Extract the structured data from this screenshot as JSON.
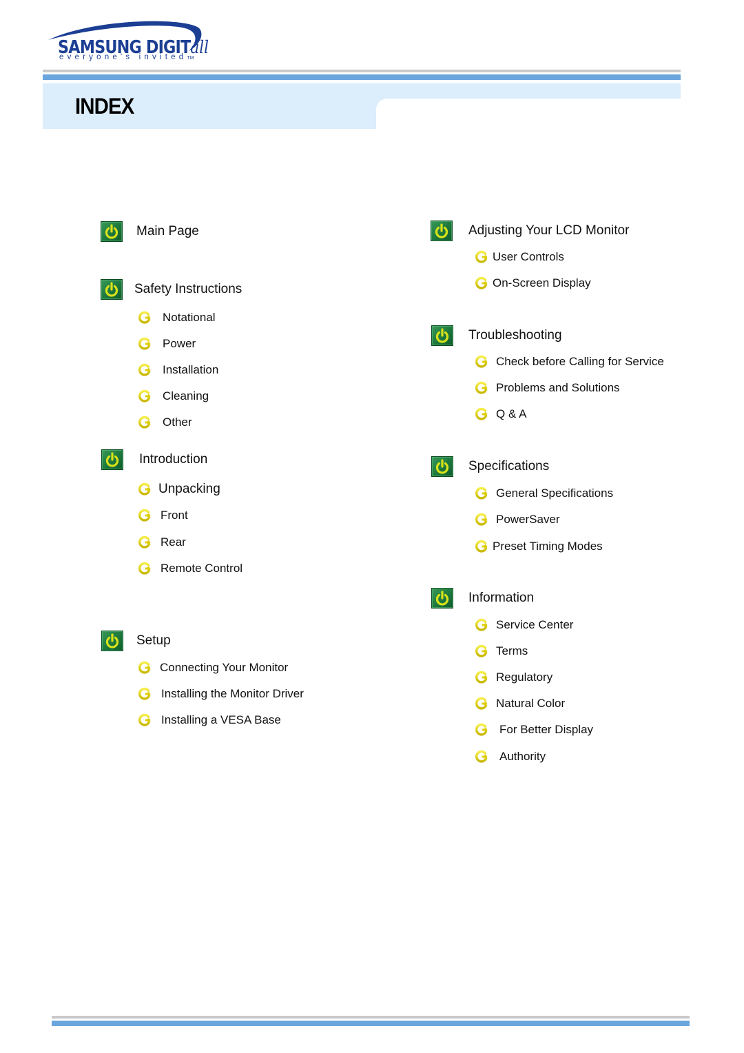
{
  "brand": {
    "logo_word": "SAMSUNG DIGIT",
    "logo_word_suffix": "all",
    "logo_tagline": "everyone's invited",
    "logo_tm": "TM",
    "colors": {
      "brand_blue": "#1c3f94",
      "header_bar_blue": "#6aa6dd",
      "header_panel": "#dcedfb",
      "divider_grey": "#c9c9c9",
      "icon_green": "#1f7a3e",
      "icon_yellow": "#e8e21c"
    }
  },
  "header": {
    "title": "INDEX"
  },
  "left_column": [
    {
      "title": "Main Page",
      "icon": "power-icon",
      "items": []
    },
    {
      "title": "Safety Instructions",
      "icon": "power-icon",
      "items": [
        {
          "label": "Notational",
          "icon": "arrow-circle-icon"
        },
        {
          "label": "Power",
          "icon": "arrow-circle-icon"
        },
        {
          "label": "Installation",
          "icon": "arrow-circle-icon"
        },
        {
          "label": "Cleaning",
          "icon": "arrow-circle-icon"
        },
        {
          "label": "Other",
          "icon": "arrow-circle-icon"
        }
      ]
    },
    {
      "title": "Introduction",
      "icon": "power-icon",
      "items": [
        {
          "label": "Unpacking",
          "icon": "arrow-circle-icon"
        },
        {
          "label": "Front",
          "icon": "arrow-circle-icon"
        },
        {
          "label": "Rear",
          "icon": "arrow-circle-icon"
        },
        {
          "label": "Remote Control",
          "icon": "arrow-circle-icon"
        }
      ]
    },
    {
      "title": "Setup",
      "icon": "power-icon",
      "items": [
        {
          "label": "Connecting Your Monitor",
          "icon": "arrow-circle-icon"
        },
        {
          "label": "Installing the Monitor Driver",
          "icon": "arrow-circle-icon"
        },
        {
          "label": "Installing a VESA Base",
          "icon": "arrow-circle-icon"
        }
      ]
    }
  ],
  "right_column": [
    {
      "title": "Adjusting Your LCD Monitor",
      "icon": "power-icon",
      "items": [
        {
          "label": "User Controls",
          "icon": "arrow-circle-icon"
        },
        {
          "label": "On-Screen Display",
          "icon": "arrow-circle-icon"
        }
      ]
    },
    {
      "title": "Troubleshooting",
      "icon": "power-icon",
      "items": [
        {
          "label": "Check before Calling for Service",
          "icon": "arrow-circle-icon"
        },
        {
          "label": "Problems and Solutions",
          "icon": "arrow-circle-icon"
        },
        {
          "label": "Q & A",
          "icon": "arrow-circle-icon"
        }
      ]
    },
    {
      "title": "Specifications",
      "icon": "power-icon",
      "items": [
        {
          "label": "General Specifications",
          "icon": "arrow-circle-icon"
        },
        {
          "label": "PowerSaver",
          "icon": "arrow-circle-icon"
        },
        {
          "label": "Preset Timing Modes",
          "icon": "arrow-circle-icon"
        }
      ]
    },
    {
      "title": "Information",
      "icon": "power-icon",
      "items": [
        {
          "label": "Service Center",
          "icon": "arrow-circle-icon"
        },
        {
          "label": "Terms",
          "icon": "arrow-circle-icon"
        },
        {
          "label": "Regulatory",
          "icon": "arrow-circle-icon"
        },
        {
          "label": "Natural Color",
          "icon": "arrow-circle-icon"
        },
        {
          "label": "For Better Display",
          "icon": "arrow-circle-icon"
        },
        {
          "label": "Authority",
          "icon": "arrow-circle-icon"
        }
      ]
    }
  ]
}
